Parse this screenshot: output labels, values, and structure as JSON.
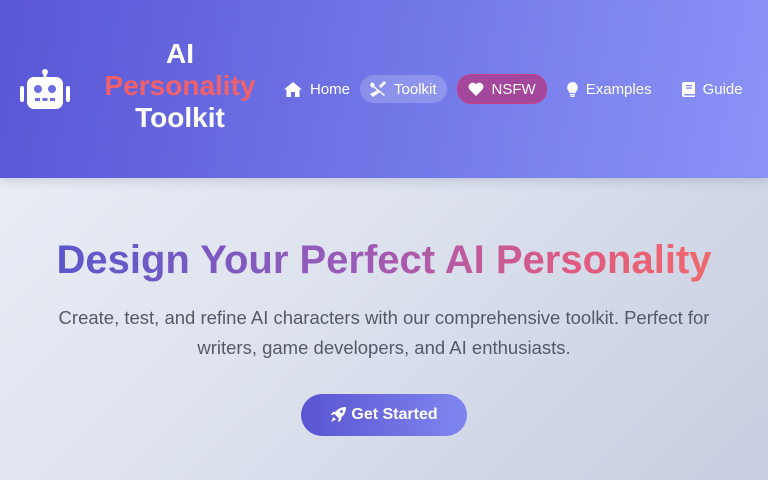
{
  "header": {
    "logo_icon": "robot-icon",
    "logo_line1": "AI",
    "logo_line2": "Personality",
    "logo_line3": "Toolkit",
    "nav": [
      {
        "label": "Home",
        "icon": "home-icon"
      },
      {
        "label": "Toolkit",
        "icon": "tools-icon",
        "active": true
      },
      {
        "label": "NSFW",
        "icon": "heart-icon"
      },
      {
        "label": "Examples",
        "icon": "lightbulb-icon"
      },
      {
        "label": "Guide",
        "icon": "book-icon"
      }
    ]
  },
  "hero": {
    "title": "Design Your Perfect AI Personality",
    "subtitle": "Create, test, and refine AI characters with our comprehensive toolkit. Perfect for writers, game developers, and AI enthusiasts.",
    "cta_label": "Get Started",
    "cta_icon": "rocket-icon"
  },
  "colors": {
    "header_start": "#5a56d6",
    "header_end": "#8b93f8",
    "accent": "#f2606b",
    "nsfw_bg": "#a4469b"
  }
}
